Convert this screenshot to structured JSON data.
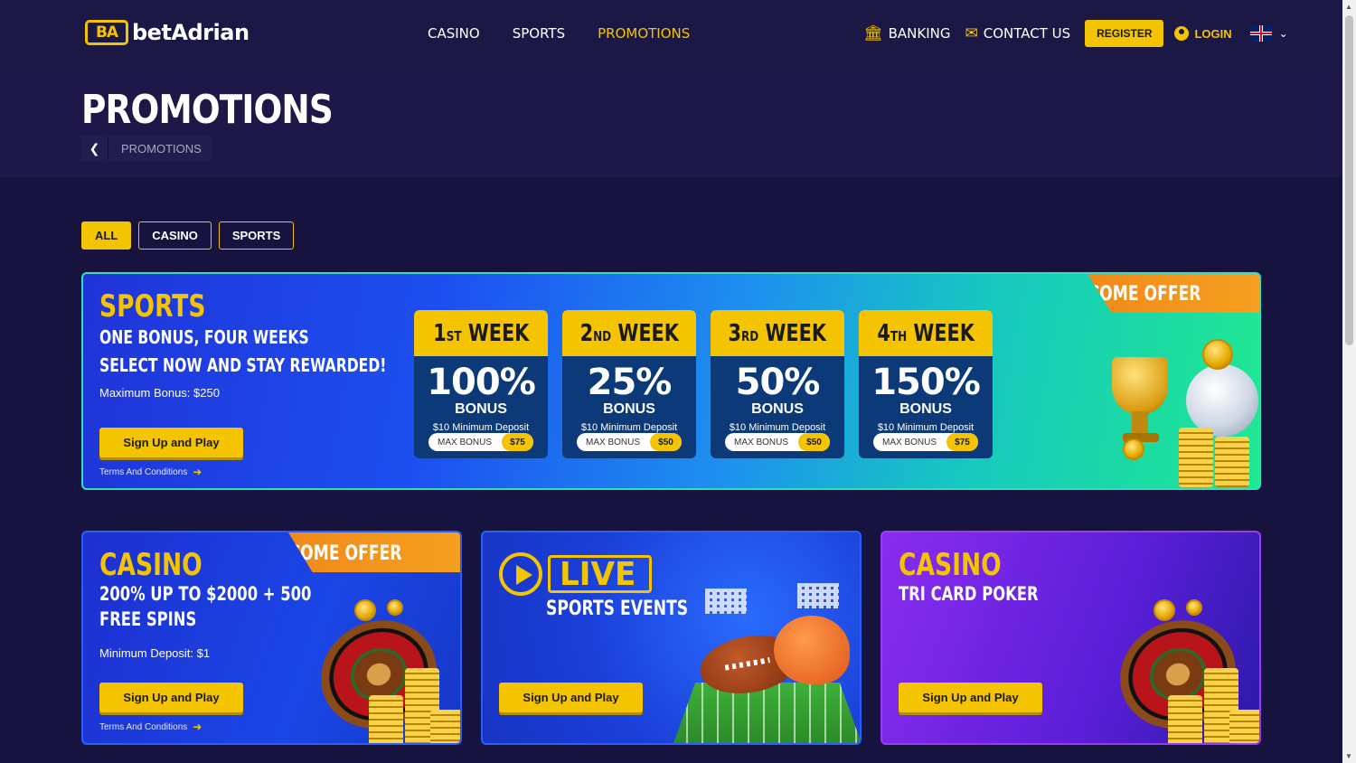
{
  "brand": {
    "mark": "BA",
    "name": "betAdrian"
  },
  "nav": [
    {
      "label": "CASINO",
      "active": false
    },
    {
      "label": "SPORTS",
      "active": false
    },
    {
      "label": "PROMOTIONS",
      "active": true
    }
  ],
  "header_right": {
    "banking": "BANKING",
    "contact": "CONTACT US",
    "register": "REGISTER",
    "login": "LOGIN"
  },
  "page": {
    "title": "PROMOTIONS",
    "breadcrumb": "PROMOTIONS"
  },
  "filters": [
    {
      "label": "ALL",
      "active": true
    },
    {
      "label": "CASINO",
      "active": false
    },
    {
      "label": "SPORTS",
      "active": false
    }
  ],
  "sports_promo": {
    "heading": "SPORTS",
    "line1": "ONE BONUS, FOUR WEEKS",
    "line2": "SELECT NOW AND STAY REWARDED!",
    "max_bonus": "Maximum Bonus: $250",
    "cta": "Sign Up and Play",
    "terms": "Terms And Conditions",
    "ribbon": "WELCOME OFFER",
    "weeks": [
      {
        "num": "1",
        "suffix": "ST",
        "word": "WEEK",
        "percent": "100%",
        "bonus": "BONUS",
        "min": "$10 Minimum Deposit",
        "max_label": "MAX BONUS",
        "max_value": "$75"
      },
      {
        "num": "2",
        "suffix": "ND",
        "word": "WEEK",
        "percent": "25%",
        "bonus": "BONUS",
        "min": "$10 Minimum Deposit",
        "max_label": "MAX BONUS",
        "max_value": "$50"
      },
      {
        "num": "3",
        "suffix": "RD",
        "word": "WEEK",
        "percent": "50%",
        "bonus": "BONUS",
        "min": "$10 Minimum Deposit",
        "max_label": "MAX BONUS",
        "max_value": "$50"
      },
      {
        "num": "4",
        "suffix": "TH",
        "word": "WEEK",
        "percent": "150%",
        "bonus": "BONUS",
        "min": "$10 Minimum Deposit",
        "max_label": "MAX BONUS",
        "max_value": "$75"
      }
    ]
  },
  "cards": [
    {
      "heading": "CASINO",
      "line1": "200% UP TO $2000 + 500",
      "line2": "FREE SPINS",
      "min": "Minimum Deposit: $1",
      "cta": "Sign Up and Play",
      "terms": "Terms And Conditions",
      "ribbon": "WELCOME OFFER"
    },
    {
      "live": "LIVE",
      "line1": "SPORTS EVENTS",
      "cta": "Sign Up and Play"
    },
    {
      "heading": "CASINO",
      "line1": "TRI CARD POKER",
      "cta": "Sign Up and Play"
    }
  ],
  "colors": {
    "accent": "#f5c400",
    "background": "#17133f",
    "header": "#1c1846"
  }
}
